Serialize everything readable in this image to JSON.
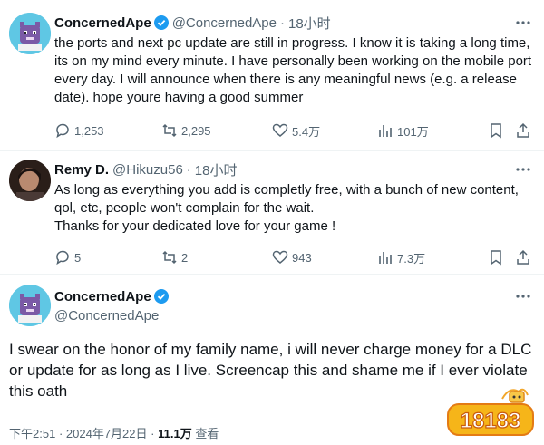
{
  "tweet1": {
    "name": "ConcernedApe",
    "handle": "@ConcernedApe",
    "separator": "·",
    "time": "18小时",
    "text": "the ports and next pc update are still in progress. I know it is taking a long time, its on my mind every minute. I have personally been working on the mobile port every day. I will announce when there is any meaningful news (e.g. a release date). hope youre having a good summer",
    "replies": "1,253",
    "retweets": "2,295",
    "likes": "5.4万",
    "views": "101万"
  },
  "tweet2": {
    "name": "Remy D.",
    "handle": "@Hikuzu56",
    "separator": "·",
    "time": "18小时",
    "text_line1": "As long as everything you add is completly free, with a bunch of new content, qol, etc, people won't complain for the wait.",
    "text_line2": "Thanks for your dedicated love for your game !",
    "replies": "5",
    "retweets": "2",
    "likes": "943",
    "views": "7.3万"
  },
  "tweet3": {
    "name": "ConcernedApe",
    "handle": "@ConcernedApe",
    "text": "I swear on the honor of my family name,  i will never charge money for a DLC or update for as long as I live. Screencap this and shame me if I ever violate this oath",
    "time": "下午2:51",
    "date": "2024年7月22日",
    "views_count": "11.1万",
    "views_label": "查看",
    "separator": "·"
  },
  "watermark": "18183",
  "colors": {
    "text": "#0f1419",
    "secondary": "#536471",
    "verified": "#1d9bf0",
    "divider": "#eff3f4"
  }
}
